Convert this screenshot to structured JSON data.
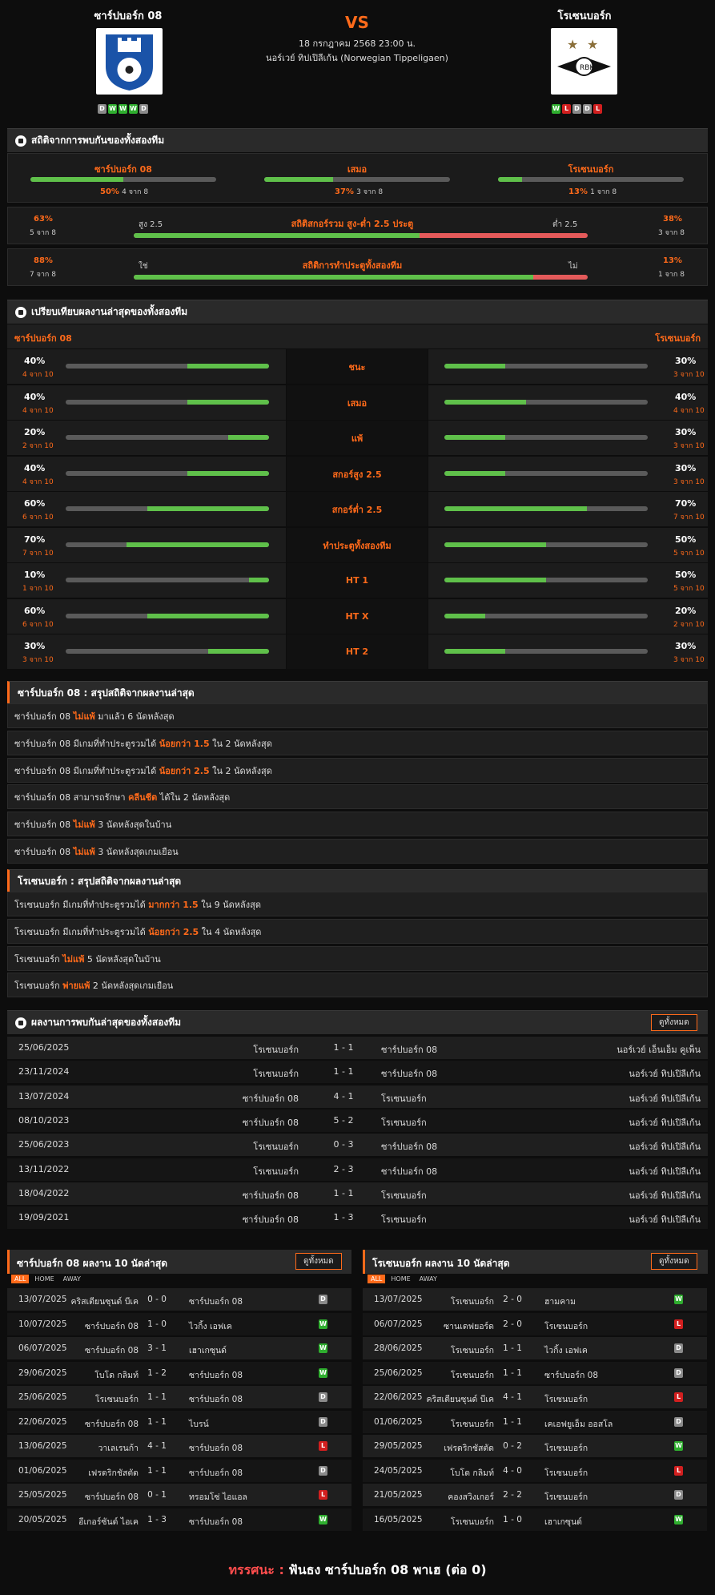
{
  "match": {
    "home": "ซาร์ปบอร์ก 08",
    "away": "โรเซนบอร์ก",
    "vs": "VS",
    "date": "18 กรกฎาคม 2568 23:00 น.",
    "league": "นอร์เวย์ ทิปเปิลีเก้น (Norwegian Tippeligaen)",
    "home_form": [
      "D",
      "W",
      "W",
      "W",
      "D"
    ],
    "away_form": [
      "W",
      "L",
      "D",
      "D",
      "L"
    ]
  },
  "h2h_stats": {
    "title": "สถิติจากการพบกันของทั้งสองทีม",
    "home": {
      "label": "ซาร์ปบอร์ก 08",
      "pct": "50%",
      "of": "4 จาก 8",
      "value": 0.5
    },
    "draw": {
      "label": "เสมอ",
      "pct": "37%",
      "of": "3 จาก 8",
      "value": 0.37
    },
    "away": {
      "label": "โรเซนบอร์ก",
      "pct": "13%",
      "of": "1 จาก 8",
      "value": 0.13
    },
    "ou": {
      "title": "สถิติสกอร์รวม สูง-ต่ำ 2.5 ประตู",
      "left_pct": "63%",
      "left_of": "5 จาก 8",
      "left_label": "สูง 2.5",
      "right_label": "ต่ำ 2.5",
      "right_pct": "38%",
      "right_of": "3 จาก 8",
      "value": 0.63
    },
    "btts": {
      "title": "สถิติการทำประตูทั้งสองทีม",
      "left_pct": "88%",
      "left_of": "7 จาก 8",
      "left_label": "ใช่",
      "right_label": "ไม่",
      "right_pct": "13%",
      "right_of": "1 จาก 8",
      "value": 0.88
    }
  },
  "compare": {
    "title": "เปรียบเทียบผลงานล่าสุดของทั้งสองทีม",
    "home": "ซาร์ปบอร์ก 08",
    "away": "โรเซนบอร์ก",
    "rows": [
      {
        "label": "ชนะ",
        "hp": "40%",
        "hs": "4 จาก 10",
        "hv": 0.4,
        "ap": "30%",
        "as": "3 จาก 10",
        "av": 0.3
      },
      {
        "label": "เสมอ",
        "hp": "40%",
        "hs": "4 จาก 10",
        "hv": 0.4,
        "ap": "40%",
        "as": "4 จาก 10",
        "av": 0.4
      },
      {
        "label": "แพ้",
        "hp": "20%",
        "hs": "2 จาก 10",
        "hv": 0.2,
        "ap": "30%",
        "as": "3 จาก 10",
        "av": 0.3
      },
      {
        "label": "สกอร์สูง 2.5",
        "hp": "40%",
        "hs": "4 จาก 10",
        "hv": 0.4,
        "ap": "30%",
        "as": "3 จาก 10",
        "av": 0.3
      },
      {
        "label": "สกอร์ต่ำ 2.5",
        "hp": "60%",
        "hs": "6 จาก 10",
        "hv": 0.6,
        "ap": "70%",
        "as": "7 จาก 10",
        "av": 0.7
      },
      {
        "label": "ทำประตูทั้งสองทีม",
        "hp": "70%",
        "hs": "7 จาก 10",
        "hv": 0.7,
        "ap": "50%",
        "as": "5 จาก 10",
        "av": 0.5
      },
      {
        "label": "HT 1",
        "hp": "10%",
        "hs": "1 จาก 10",
        "hv": 0.1,
        "ap": "50%",
        "as": "5 จาก 10",
        "av": 0.5
      },
      {
        "label": "HT X",
        "hp": "60%",
        "hs": "6 จาก 10",
        "hv": 0.6,
        "ap": "20%",
        "as": "2 จาก 10",
        "av": 0.2
      },
      {
        "label": "HT 2",
        "hp": "30%",
        "hs": "3 จาก 10",
        "hv": 0.3,
        "ap": "30%",
        "as": "3 จาก 10",
        "av": 0.3
      }
    ]
  },
  "home_summary": {
    "title": "ซาร์ปบอร์ก 08 : สรุปสถิติจากผลงานล่าสุด",
    "rows": [
      [
        "ซาร์ปบอร์ก 08 ",
        "ไม่แพ้",
        " มาแล้ว 6 นัดหลังสุด"
      ],
      [
        "ซาร์ปบอร์ก 08 มีเกมที่ทำประตูรวมได้ ",
        "น้อยกว่า 1.5",
        " ใน 2 นัดหลังสุด"
      ],
      [
        "ซาร์ปบอร์ก 08 มีเกมที่ทำประตูรวมได้ ",
        "น้อยกว่า 2.5",
        " ใน 2 นัดหลังสุด"
      ],
      [
        "ซาร์ปบอร์ก 08 สามารถรักษา ",
        "คลีนชีต",
        " ได้ใน 2 นัดหลังสุด"
      ],
      [
        "ซาร์ปบอร์ก 08 ",
        "ไม่แพ้",
        " 3 นัดหลังสุดในบ้าน"
      ],
      [
        "ซาร์ปบอร์ก 08 ",
        "ไม่แพ้",
        " 3 นัดหลังสุดเกมเยือน"
      ]
    ]
  },
  "away_summary": {
    "title": "โรเซนบอร์ก : สรุปสถิติจากผลงานล่าสุด",
    "rows": [
      [
        "โรเซนบอร์ก มีเกมที่ทำประตูรวมได้ ",
        "มากกว่า 1.5",
        " ใน 9 นัดหลังสุด"
      ],
      [
        "โรเซนบอร์ก มีเกมที่ทำประตูรวมได้ ",
        "น้อยกว่า 2.5",
        " ใน 4 นัดหลังสุด"
      ],
      [
        "โรเซนบอร์ก ",
        "ไม่แพ้",
        " 5 นัดหลังสุดในบ้าน"
      ],
      [
        "โรเซนบอร์ก ",
        "พ่ายแพ้",
        " 2 นัดหลังสุดเกมเยือน"
      ]
    ]
  },
  "h2h": {
    "title": "ผลงานการพบกันล่าสุดของทั้งสองทีม",
    "see_all": "ดูทั้งหมด",
    "rows": [
      [
        "25/06/2025",
        "โรเซนบอร์ก",
        "1 - 1",
        "ซาร์ปบอร์ก 08",
        "นอร์เวย์ เอ็นเอ็ม คูเพ็น"
      ],
      [
        "23/11/2024",
        "โรเซนบอร์ก",
        "1 - 1",
        "ซาร์ปบอร์ก 08",
        "นอร์เวย์ ทิปเปิลีเก้น"
      ],
      [
        "13/07/2024",
        "ซาร์ปบอร์ก 08",
        "4 - 1",
        "โรเซนบอร์ก",
        "นอร์เวย์ ทิปเปิลีเก้น"
      ],
      [
        "08/10/2023",
        "ซาร์ปบอร์ก 08",
        "5 - 2",
        "โรเซนบอร์ก",
        "นอร์เวย์ ทิปเปิลีเก้น"
      ],
      [
        "25/06/2023",
        "โรเซนบอร์ก",
        "0 - 3",
        "ซาร์ปบอร์ก 08",
        "นอร์เวย์ ทิปเปิลีเก้น"
      ],
      [
        "13/11/2022",
        "โรเซนบอร์ก",
        "2 - 3",
        "ซาร์ปบอร์ก 08",
        "นอร์เวย์ ทิปเปิลีเก้น"
      ],
      [
        "18/04/2022",
        "ซาร์ปบอร์ก 08",
        "1 - 1",
        "โรเซนบอร์ก",
        "นอร์เวย์ ทิปเปิลีเก้น"
      ],
      [
        "19/09/2021",
        "ซาร์ปบอร์ก 08",
        "1 - 3",
        "โรเซนบอร์ก",
        "นอร์เวย์ ทิปเปิลีเก้น"
      ]
    ]
  },
  "home_last": {
    "title": "ซาร์ปบอร์ก 08 ผลงาน 10 นัดล่าสุด",
    "see_all": "ดูทั้งหมด",
    "tabs": [
      "ALL",
      "HOME",
      "AWAY"
    ],
    "rows": [
      [
        "13/07/2025",
        "คริสเตียนซุนด์ บีเค",
        "0 - 0",
        "ซาร์ปบอร์ก 08",
        "D"
      ],
      [
        "10/07/2025",
        "ซาร์ปบอร์ก 08",
        "1 - 0",
        "ไวกิ้ง เอฟเค",
        "W"
      ],
      [
        "06/07/2025",
        "ซาร์ปบอร์ก 08",
        "3 - 1",
        "เฮาเกซุนด์",
        "W"
      ],
      [
        "29/06/2025",
        "โบโด กลิมท์",
        "1 - 2",
        "ซาร์ปบอร์ก 08",
        "W"
      ],
      [
        "25/06/2025",
        "โรเซนบอร์ก",
        "1 - 1",
        "ซาร์ปบอร์ก 08",
        "D"
      ],
      [
        "22/06/2025",
        "ซาร์ปบอร์ก 08",
        "1 - 1",
        "ไบรน์",
        "D"
      ],
      [
        "13/06/2025",
        "วาเลเรนก้า",
        "4 - 1",
        "ซาร์ปบอร์ก 08",
        "L"
      ],
      [
        "01/06/2025",
        "เฟรดริกชัสตัด",
        "1 - 1",
        "ซาร์ปบอร์ก 08",
        "D"
      ],
      [
        "25/05/2025",
        "ซาร์ปบอร์ก 08",
        "0 - 1",
        "ทรอมโซ่ ไอแอล",
        "L"
      ],
      [
        "20/05/2025",
        "อีเกอร์ซันด์ ไอเค",
        "1 - 3",
        "ซาร์ปบอร์ก 08",
        "W"
      ]
    ]
  },
  "away_last": {
    "title": "โรเซนบอร์ก ผลงาน 10 นัดล่าสุด",
    "see_all": "ดูทั้งหมด",
    "tabs": [
      "ALL",
      "HOME",
      "AWAY"
    ],
    "rows": [
      [
        "13/07/2025",
        "โรเซนบอร์ก",
        "2 - 0",
        "ฮามคาม",
        "W"
      ],
      [
        "06/07/2025",
        "ซานเดฟยอร์ด",
        "2 - 0",
        "โรเซนบอร์ก",
        "L"
      ],
      [
        "28/06/2025",
        "โรเซนบอร์ก",
        "1 - 1",
        "ไวกิ้ง เอฟเค",
        "D"
      ],
      [
        "25/06/2025",
        "โรเซนบอร์ก",
        "1 - 1",
        "ซาร์ปบอร์ก 08",
        "D"
      ],
      [
        "22/06/2025",
        "คริสเตียนซุนด์ บีเค",
        "4 - 1",
        "โรเซนบอร์ก",
        "L"
      ],
      [
        "01/06/2025",
        "โรเซนบอร์ก",
        "1 - 1",
        "เคเอฟยูเอ็ม ออสโล",
        "D"
      ],
      [
        "29/05/2025",
        "เฟรดริกชัสตัด",
        "0 - 2",
        "โรเซนบอร์ก",
        "W"
      ],
      [
        "24/05/2025",
        "โบโด กลิมท์",
        "4 - 0",
        "โรเซนบอร์ก",
        "L"
      ],
      [
        "21/05/2025",
        "คองสวิงเกอร์",
        "2 - 2",
        "โรเซนบอร์ก",
        "D"
      ],
      [
        "16/05/2025",
        "โรเซนบอร์ก",
        "1 - 0",
        "เฮาเกซุนด์",
        "W"
      ]
    ]
  },
  "verdict": {
    "label": "ทรรศนะ :",
    "text": "ฟันธง ซาร์ปบอร์ก 08 พาเฮ (ต่อ 0)"
  },
  "colors": {
    "accent": "#ff6a1a",
    "bar_green": "#5fc04a",
    "bar_red": "#e45a5a",
    "win": "#2fae2f",
    "loss": "#d21f1f",
    "draw": "#8a8a8a"
  }
}
